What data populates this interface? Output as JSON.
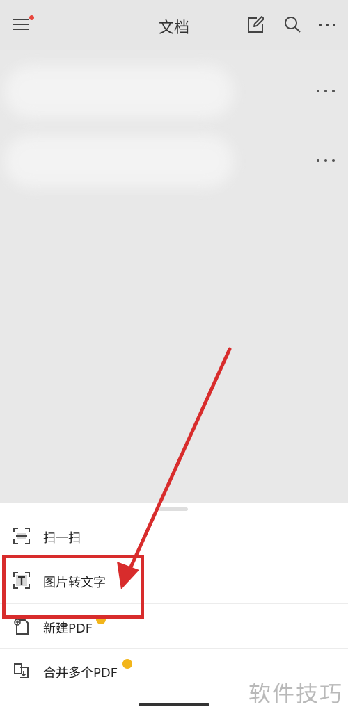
{
  "header": {
    "title": "文档"
  },
  "colors": {
    "notify_dot": "#e8453c",
    "annotation_red": "#d82c2c",
    "vip_badge": "#f2b51b"
  },
  "menu": {
    "items": [
      {
        "label": "扫一扫",
        "icon": "scan-icon"
      },
      {
        "label": "图片转文字",
        "icon": "image-to-text-icon"
      },
      {
        "label": "新建PDF",
        "icon": "new-pdf-icon",
        "badge": "vip-badge"
      },
      {
        "label": "合并多个PDF",
        "icon": "merge-pdf-icon",
        "badge": "vip-badge"
      }
    ]
  },
  "watermark": "软件技巧"
}
